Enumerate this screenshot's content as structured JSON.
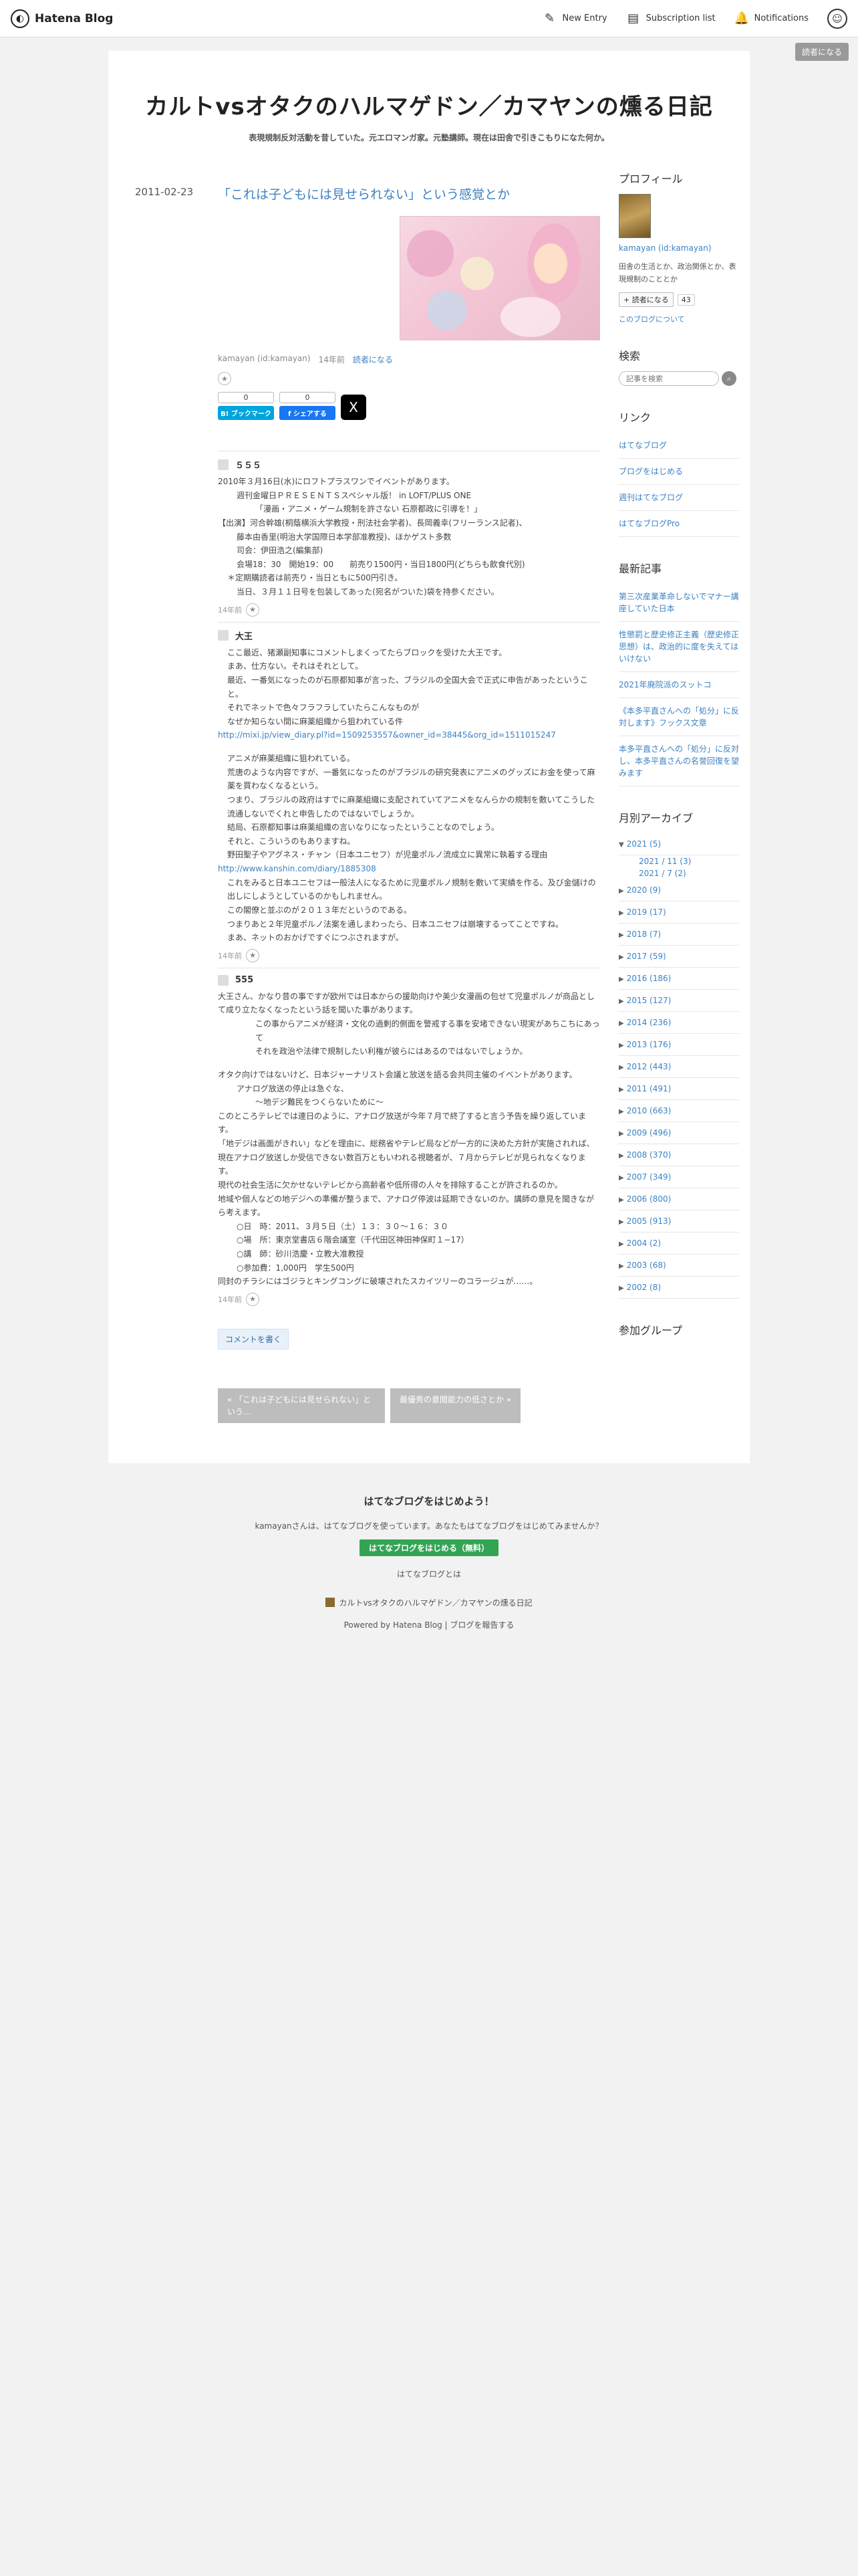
{
  "global_header": {
    "logo_text": "Hatena Blog",
    "new_entry": "New Entry",
    "subscription_list": "Subscription list",
    "notifications": "Notifications"
  },
  "subscribe_badge": "読者になる",
  "blog": {
    "title": "カルトvsオタクのハルマゲドン／カマヤンの燻る日記",
    "description": "表現規制反対活動を昔していた。元エロマンガ家。元塾講師。現在は田舎で引きこもりになた何か。"
  },
  "entry": {
    "date": "2011-02-23",
    "title": "「これは子どもには見せられない」という感覚とか",
    "author": "kamayan (id:kamayan)",
    "age": "14年前",
    "subscribe": "読者になる",
    "hatebu_count": "0",
    "hatebu_label": "B! ブックマーク",
    "fb_count": "0",
    "fb_label": "f シェアする",
    "x_label": "X"
  },
  "comments": [
    {
      "name": "５５５",
      "age": "14年前",
      "lines": [
        {
          "t": "2010年３月16日(水)にロフトプラスワンでイベントがあります。",
          "c": ""
        },
        {
          "t": "週刊金曜日ＰＲＥＳＥＮＴＳスペシャル版！ in LOFT/PLUS ONE",
          "c": "ind2"
        },
        {
          "t": "「漫画・アニメ・ゲーム規制を許さない 石原都政に引導を！」",
          "c": "ind3"
        },
        {
          "t": "【出演】河合幹雄(桐蔭横浜大学教授・刑法社会学者)、長岡義幸(フリーランス記者)、",
          "c": ""
        },
        {
          "t": "藤本由香里(明治大学国際日本学部准教授)、ほかゲスト多数",
          "c": "ind2"
        },
        {
          "t": "司会：伊田浩之(編集部)",
          "c": "ind2"
        },
        {
          "t": "会場18：30　開始19：00　　前売り1500円・当日1800円(どちらも飲食代別)",
          "c": "ind2"
        },
        {
          "t": "＊定期購読者は前売り・当日ともに500円引き。",
          "c": "ind"
        },
        {
          "t": "当日、３月１１日号を包装してあった(宛名がついた)袋を持参ください。",
          "c": "ind2"
        }
      ]
    },
    {
      "name": "大王",
      "age": "14年前",
      "lines": [
        {
          "t": "ここ最近、猪瀬副知事にコメントしまくってたらブロックを受けた大王です。",
          "c": "ind"
        },
        {
          "t": "まあ、仕方ない。それはそれとして。",
          "c": "ind"
        },
        {
          "t": "最近、一番気になったのが石原都知事が言った、ブラジルの全国大会で正式に申告があったということ。",
          "c": "ind"
        },
        {
          "t": "それでネットで色々フラフラしていたらこんなものが",
          "c": "ind"
        },
        {
          "t": "なぜか知らない間に麻薬組織から狙われている件",
          "c": "ind"
        },
        {
          "t": "http://mixi.jp/view_diary.pl?id=1509253557&owner_id=38445&org_id=1511015247",
          "c": "link"
        },
        {
          "t": "",
          "c": "gap"
        },
        {
          "t": "アニメが麻薬組織に狙われている。",
          "c": "ind"
        },
        {
          "t": "荒唐のような内容ですが、一番気になったのがブラジルの研究発表にアニメのグッズにお金を使って麻薬を買わなくなるという。",
          "c": "ind"
        },
        {
          "t": "つまり、ブラジルの政府はすでに麻薬組織に支配されていてアニメをなんらかの規制を敷いてこうした流通しないでくれと申告したのではないでしょうか。",
          "c": "ind"
        },
        {
          "t": "結局、石原都知事は麻薬組織の言いなりになったということなのでしょう。",
          "c": "ind"
        },
        {
          "t": "それと、こういうのもありますね。",
          "c": "ind"
        },
        {
          "t": "野田聖子やアグネス・チャン（日本ユニセフ）が児童ポルノ流成立に異常に執着する理由",
          "c": "ind"
        },
        {
          "t": "http://www.kanshin.com/diary/1885308",
          "c": "link"
        },
        {
          "t": "これをみると日本ユニセフは一般法人になるために児童ポルノ規制を敷いて実績を作る。及び金儲けの出しにしようとしているのかもしれません。",
          "c": "ind"
        },
        {
          "t": "この閣僚と並ぶのが２０１３年だというのである。",
          "c": "ind"
        },
        {
          "t": "つまりあと２年児童ポルノ法案を通しまわったら、日本ユニセフは崩壊するってことですね。",
          "c": "ind"
        },
        {
          "t": "まあ、ネットのおかげですぐにつぶされますが。",
          "c": "ind"
        }
      ]
    },
    {
      "name": "555",
      "age": "14年前",
      "lines": [
        {
          "t": "大王さん、かなり昔の事ですが欧州では日本からの援助向けや美少女漫画の包せて児童ポルノが商品として成り立たなくなったという話を聞いた事があります。",
          "c": ""
        },
        {
          "t": "この事からアニメが経済・文化の過剰的側面を警戒する事を安堵できない現実があちこちにあって",
          "c": "ind3"
        },
        {
          "t": "それを政治や法律で規制したい利権が彼らにはあるのではないでしょうか。",
          "c": "ind3"
        },
        {
          "t": "",
          "c": "gap"
        },
        {
          "t": "オタク向けではないけど、日本ジャーナリスト会議と放送を語る会共同主催のイベントがあります。",
          "c": ""
        },
        {
          "t": "アナログ放送の停止は急ぐな、",
          "c": "ind2"
        },
        {
          "t": "〜地デジ難民をつくらないために〜",
          "c": "ind3"
        },
        {
          "t": "このところテレビでは連日のように、アナログ放送が今年７月で終了すると言う予告を繰り返しています。",
          "c": ""
        },
        {
          "t": "「地デジは画面がきれい」などを理由に、総務省やテレビ局などが一方的に決めた方針が実施されれば、",
          "c": ""
        },
        {
          "t": "現在アナログ放送しか受信できない数百万ともいわれる視聴者が、７月からテレビが見られなくなります。",
          "c": ""
        },
        {
          "t": "現代の社会生活に欠かせないテレビから高齢者や低所得の人々を排除することが許されるのか。",
          "c": ""
        },
        {
          "t": "地域や個人などの地デジへの準備が整うまで、アナログ停波は延期できないのか。講師の意見を聞きながら考えます。",
          "c": ""
        },
        {
          "t": "○日　時：2011、３月５日（土）１３：３０〜１６：３０",
          "c": "ind2"
        },
        {
          "t": "○場　所：東京堂書店６階会議室（千代田区神田神保町１−17）",
          "c": "ind2"
        },
        {
          "t": "○講　師：砂川浩慶・立教大准教授",
          "c": "ind2"
        },
        {
          "t": "○参加費：1,000円　学生500円",
          "c": "ind2"
        },
        {
          "t": "同封のチラシにはゴジラとキングコングに破壊されたスカイツリーのコラージュが……。",
          "c": ""
        }
      ]
    }
  ],
  "comment_button": "コメントを書く",
  "pager": {
    "prev": "« 「これは子どもには見せられない」という...",
    "next": "最優秀の意閲能力の低さとか »"
  },
  "sidebar": {
    "profile_title": "プロフィール",
    "profile_name": "kamayan (id:kamayan)",
    "profile_desc": "田舎の生活とか、政治関係とか、表現規制のこととか",
    "subscribe_label": "+ 読者になる",
    "subscribe_count": "43",
    "about_link": "このブログについて",
    "search_title": "検索",
    "search_placeholder": "記事を検索",
    "links_title": "リンク",
    "links": [
      "はてなブログ",
      "ブログをはじめる",
      "週刊はてなブログ",
      "はてなブログPro"
    ],
    "recent_title": "最新記事",
    "recent": [
      "第三次産業革命しないでマナー講座していた日本",
      "性懲罰と歴史修正主義（歴史修正思想）は、政治的に度を失えてはいけない",
      "2021年廃院派のスットコ",
      "《本多平直さんへの「処分」に反対します》フックス文章",
      "本多平直さんへの「処分」に反対し、本多平直さんの名誉回復を望みます"
    ],
    "archive_title": "月別アーカイブ",
    "archive": [
      {
        "label": "2021 (5)",
        "open": true
      },
      {
        "label": "2021 / 11 (3)",
        "sub": true
      },
      {
        "label": "2021 / 7 (2)",
        "sub": true
      },
      {
        "label": "2020 (9)"
      },
      {
        "label": "2019 (17)"
      },
      {
        "label": "2018 (7)"
      },
      {
        "label": "2017 (59)"
      },
      {
        "label": "2016 (186)"
      },
      {
        "label": "2015 (127)"
      },
      {
        "label": "2014 (236)"
      },
      {
        "label": "2013 (176)"
      },
      {
        "label": "2012 (443)"
      },
      {
        "label": "2011 (491)"
      },
      {
        "label": "2010 (663)"
      },
      {
        "label": "2009 (496)"
      },
      {
        "label": "2008 (370)"
      },
      {
        "label": "2007 (349)"
      },
      {
        "label": "2006 (800)"
      },
      {
        "label": "2005 (913)"
      },
      {
        "label": "2004 (2)"
      },
      {
        "label": "2003 (68)"
      },
      {
        "label": "2002 (8)"
      }
    ],
    "group_title": "参加グループ"
  },
  "footer": {
    "title": "はてなブログをはじめよう！",
    "text": "kamayanさんは、はてなブログを使っています。あなたもはてなブログをはじめてみませんか？",
    "button": "はてなブログをはじめる（無料）",
    "about": "はてなブログとは",
    "blog_name": "カルトvsオタクのハルマゲドン／カマヤンの燻る日記",
    "powered": "Powered by Hatena Blog | ブログを報告する"
  }
}
